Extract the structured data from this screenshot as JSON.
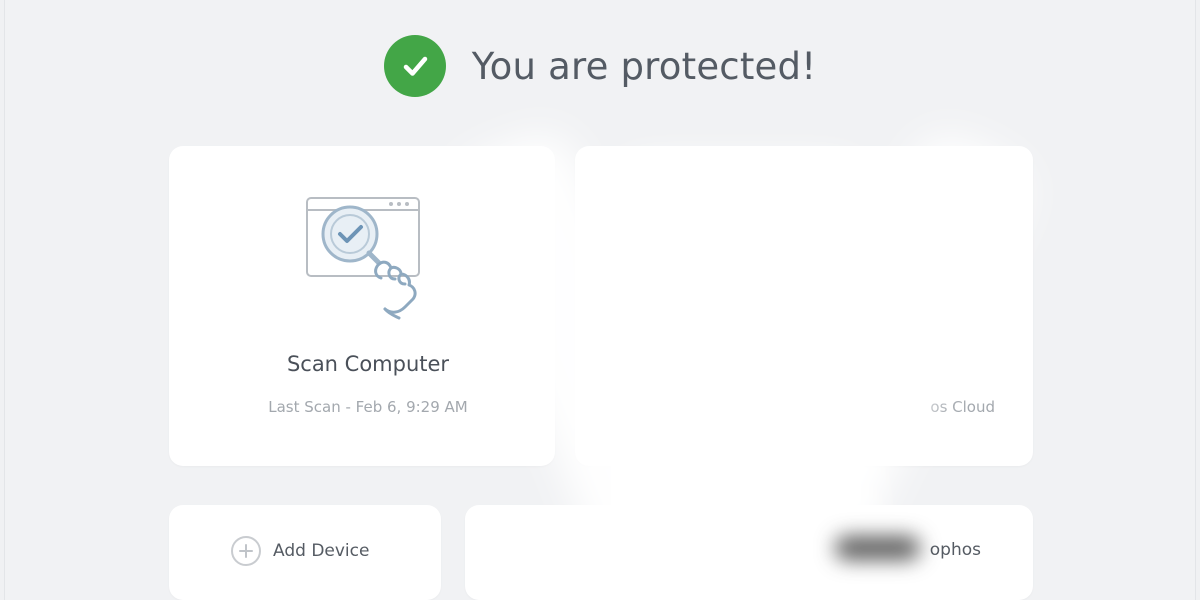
{
  "status": {
    "title": "You are protected!",
    "icon": "check-icon",
    "color": "#43a647"
  },
  "scan_card": {
    "title": "Scan Computer",
    "last_scan": "Last Scan - Feb 6, 9:29 AM",
    "illustration": "scan-illustration-icon"
  },
  "cloud_card": {
    "label": "os Cloud"
  },
  "add_device_card": {
    "label": "Add Device",
    "icon": "plus-icon"
  },
  "sophos_card": {
    "label": "ophos"
  }
}
